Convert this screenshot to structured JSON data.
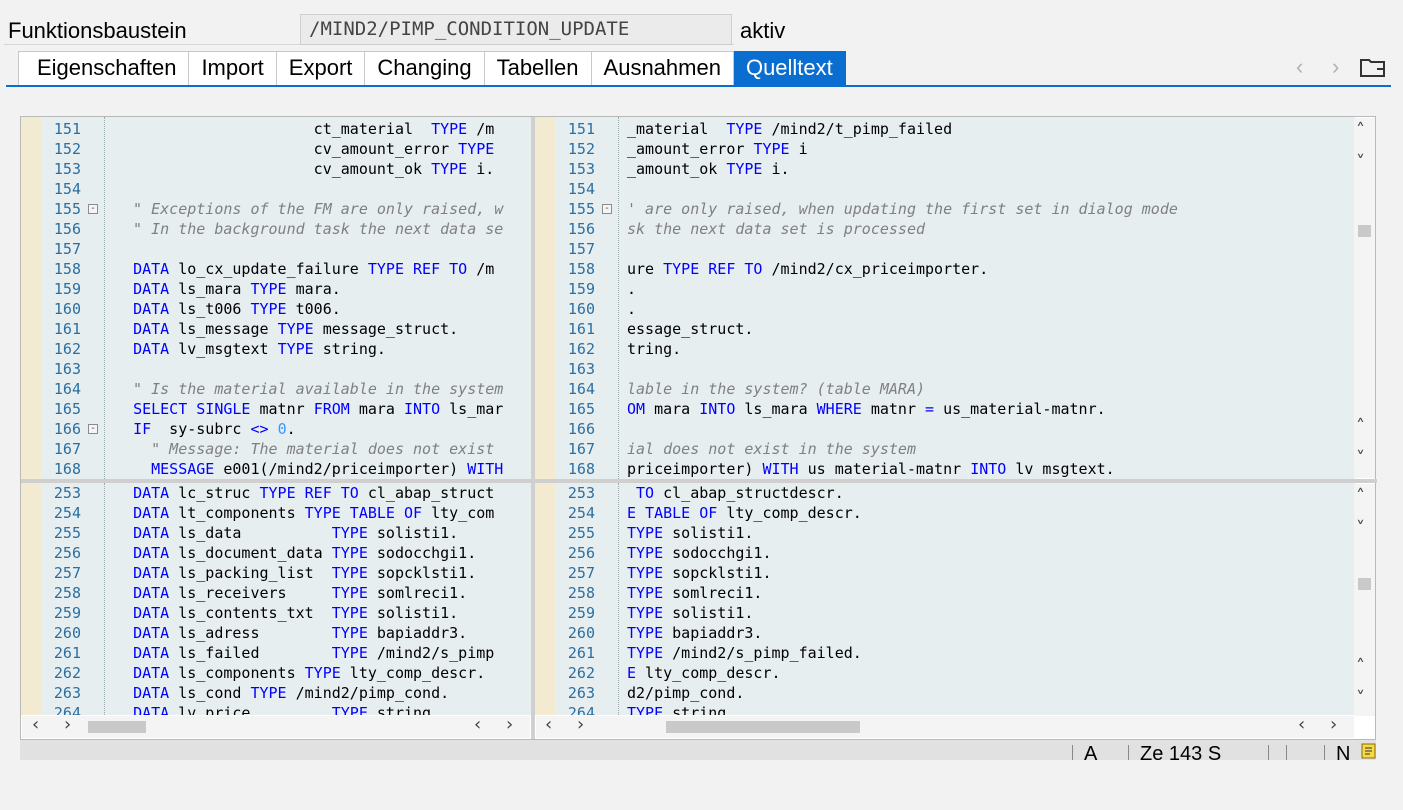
{
  "header": {
    "label": "Funktionsbaustein",
    "value": "/MIND2/PIMP_CONDITION_UPDATE",
    "status": "aktiv"
  },
  "tabs": [
    {
      "label": "Eigenschaften"
    },
    {
      "label": "Import"
    },
    {
      "label": "Export"
    },
    {
      "label": "Changing"
    },
    {
      "label": "Tabellen"
    },
    {
      "label": "Ausnahmen"
    },
    {
      "label": "Quelltext",
      "active": true
    }
  ],
  "icons": {
    "prev": "chevron-left-icon",
    "next": "chevron-right-icon",
    "folder": "folder-icon"
  },
  "colors": {
    "accent": "#0a6ed1",
    "keyword": "#0000ff",
    "comment": "#808080",
    "number": "#3399ff",
    "editor_bg": "#e7eef0",
    "gutter": "#f3ead2"
  },
  "editor": {
    "top_left": [
      {
        "n": "151",
        "t": [
          [
            "tx",
            "                      ct_material  "
          ],
          [
            "kw",
            "TYPE"
          ],
          [
            "tx",
            " /m"
          ]
        ]
      },
      {
        "n": "152",
        "t": [
          [
            "tx",
            "                      cv_amount_error "
          ],
          [
            "kw",
            "TYPE"
          ]
        ]
      },
      {
        "n": "153",
        "t": [
          [
            "tx",
            "                      cv_amount_ok "
          ],
          [
            "kw",
            "TYPE"
          ],
          [
            "tx",
            " i."
          ]
        ]
      },
      {
        "n": "154",
        "t": []
      },
      {
        "n": "155",
        "t": [
          [
            "cm",
            "  \" Exceptions of the FM are only raised, w"
          ]
        ],
        "fold": "minus"
      },
      {
        "n": "156",
        "t": [
          [
            "cm",
            "  \" In the background task the next data se"
          ]
        ]
      },
      {
        "n": "157",
        "t": []
      },
      {
        "n": "158",
        "t": [
          [
            "tx",
            "  "
          ],
          [
            "kw",
            "DATA"
          ],
          [
            "tx",
            " lo_cx_update_failure "
          ],
          [
            "kw",
            "TYPE REF TO"
          ],
          [
            "tx",
            " /m"
          ]
        ]
      },
      {
        "n": "159",
        "t": [
          [
            "tx",
            "  "
          ],
          [
            "kw",
            "DATA"
          ],
          [
            "tx",
            " ls_mara "
          ],
          [
            "kw",
            "TYPE"
          ],
          [
            "tx",
            " mara."
          ]
        ]
      },
      {
        "n": "160",
        "t": [
          [
            "tx",
            "  "
          ],
          [
            "kw",
            "DATA"
          ],
          [
            "tx",
            " ls_t006 "
          ],
          [
            "kw",
            "TYPE"
          ],
          [
            "tx",
            " t006."
          ]
        ]
      },
      {
        "n": "161",
        "t": [
          [
            "tx",
            "  "
          ],
          [
            "kw",
            "DATA"
          ],
          [
            "tx",
            " ls_message "
          ],
          [
            "kw",
            "TYPE"
          ],
          [
            "tx",
            " message_struct."
          ]
        ]
      },
      {
        "n": "162",
        "t": [
          [
            "tx",
            "  "
          ],
          [
            "kw",
            "DATA"
          ],
          [
            "tx",
            " lv_msgtext "
          ],
          [
            "kw",
            "TYPE"
          ],
          [
            "tx",
            " string."
          ]
        ]
      },
      {
        "n": "163",
        "t": []
      },
      {
        "n": "164",
        "t": [
          [
            "cm",
            "  \" Is the material available in the system"
          ]
        ]
      },
      {
        "n": "165",
        "t": [
          [
            "tx",
            "  "
          ],
          [
            "kw",
            "SELECT SINGLE"
          ],
          [
            "tx",
            " matnr "
          ],
          [
            "kw",
            "FROM"
          ],
          [
            "tx",
            " mara "
          ],
          [
            "kw",
            "INTO"
          ],
          [
            "tx",
            " ls_mar"
          ]
        ]
      },
      {
        "n": "166",
        "t": [
          [
            "tx",
            "  "
          ],
          [
            "kw",
            "IF"
          ],
          [
            "tx",
            "  sy-subrc "
          ],
          [
            "kw",
            "<>"
          ],
          [
            "tx",
            " "
          ],
          [
            "nm",
            "0"
          ],
          [
            "tx",
            "."
          ]
        ],
        "fold": "minus"
      },
      {
        "n": "167",
        "t": [
          [
            "cm",
            "    \" Message: The material does not exist"
          ]
        ]
      },
      {
        "n": "168",
        "t": [
          [
            "tx",
            "    "
          ],
          [
            "kw",
            "MESSAGE"
          ],
          [
            "tx",
            " e001(/mind2/priceimporter) "
          ],
          [
            "kw",
            "WITH"
          ]
        ]
      }
    ],
    "top_right": [
      {
        "n": "151",
        "t": [
          [
            "tx",
            "_material  "
          ],
          [
            "kw",
            "TYPE"
          ],
          [
            "tx",
            " /mind2/t_pimp_failed"
          ]
        ]
      },
      {
        "n": "152",
        "t": [
          [
            "tx",
            "_amount_error "
          ],
          [
            "kw",
            "TYPE"
          ],
          [
            "tx",
            " i"
          ]
        ]
      },
      {
        "n": "153",
        "t": [
          [
            "tx",
            "_amount_ok "
          ],
          [
            "kw",
            "TYPE"
          ],
          [
            "tx",
            " i."
          ]
        ]
      },
      {
        "n": "154",
        "t": []
      },
      {
        "n": "155",
        "t": [
          [
            "cm",
            "' are only raised, when updating the first set in dialog mode"
          ]
        ],
        "fold": "minus"
      },
      {
        "n": "156",
        "t": [
          [
            "cm",
            "sk the next data set is processed"
          ]
        ]
      },
      {
        "n": "157",
        "t": []
      },
      {
        "n": "158",
        "t": [
          [
            "tx",
            "ure "
          ],
          [
            "kw",
            "TYPE REF TO"
          ],
          [
            "tx",
            " /mind2/cx_priceimporter."
          ]
        ]
      },
      {
        "n": "159",
        "t": [
          [
            "tx",
            "."
          ]
        ]
      },
      {
        "n": "160",
        "t": [
          [
            "tx",
            "."
          ]
        ]
      },
      {
        "n": "161",
        "t": [
          [
            "tx",
            "essage_struct."
          ]
        ]
      },
      {
        "n": "162",
        "t": [
          [
            "tx",
            "tring."
          ]
        ]
      },
      {
        "n": "163",
        "t": []
      },
      {
        "n": "164",
        "t": [
          [
            "cm",
            "lable in the system? (table MARA)"
          ]
        ]
      },
      {
        "n": "165",
        "t": [
          [
            "kw",
            "OM"
          ],
          [
            "tx",
            " mara "
          ],
          [
            "kw",
            "INTO"
          ],
          [
            "tx",
            " ls_mara "
          ],
          [
            "kw",
            "WHERE"
          ],
          [
            "tx",
            " matnr "
          ],
          [
            "kw",
            "="
          ],
          [
            "tx",
            " us_material-matnr."
          ]
        ]
      },
      {
        "n": "166",
        "t": []
      },
      {
        "n": "167",
        "t": [
          [
            "cm",
            "ial does not exist in the system"
          ]
        ]
      },
      {
        "n": "168",
        "t": [
          [
            "tx",
            "priceimporter) "
          ],
          [
            "kw",
            "WITH"
          ],
          [
            "tx",
            " us material-matnr "
          ],
          [
            "kw",
            "INTO"
          ],
          [
            "tx",
            " lv msgtext."
          ]
        ]
      }
    ],
    "bottom_left": [
      {
        "n": "253",
        "t": [
          [
            "tx",
            "  "
          ],
          [
            "kw",
            "DATA"
          ],
          [
            "tx",
            " lc_struc "
          ],
          [
            "kw",
            "TYPE REF TO"
          ],
          [
            "tx",
            " cl_abap_struct"
          ]
        ]
      },
      {
        "n": "254",
        "t": [
          [
            "tx",
            "  "
          ],
          [
            "kw",
            "DATA"
          ],
          [
            "tx",
            " lt_components "
          ],
          [
            "kw",
            "TYPE TABLE OF"
          ],
          [
            "tx",
            " lty_com"
          ]
        ]
      },
      {
        "n": "255",
        "t": [
          [
            "tx",
            "  "
          ],
          [
            "kw",
            "DATA"
          ],
          [
            "tx",
            " ls_data          "
          ],
          [
            "kw",
            "TYPE"
          ],
          [
            "tx",
            " solisti1."
          ]
        ]
      },
      {
        "n": "256",
        "t": [
          [
            "tx",
            "  "
          ],
          [
            "kw",
            "DATA"
          ],
          [
            "tx",
            " ls_document_data "
          ],
          [
            "kw",
            "TYPE"
          ],
          [
            "tx",
            " sodocchgi1."
          ]
        ]
      },
      {
        "n": "257",
        "t": [
          [
            "tx",
            "  "
          ],
          [
            "kw",
            "DATA"
          ],
          [
            "tx",
            " ls_packing_list  "
          ],
          [
            "kw",
            "TYPE"
          ],
          [
            "tx",
            " sopcklsti1."
          ]
        ]
      },
      {
        "n": "258",
        "t": [
          [
            "tx",
            "  "
          ],
          [
            "kw",
            "DATA"
          ],
          [
            "tx",
            " ls_receivers     "
          ],
          [
            "kw",
            "TYPE"
          ],
          [
            "tx",
            " somlreci1."
          ]
        ]
      },
      {
        "n": "259",
        "t": [
          [
            "tx",
            "  "
          ],
          [
            "kw",
            "DATA"
          ],
          [
            "tx",
            " ls_contents_txt  "
          ],
          [
            "kw",
            "TYPE"
          ],
          [
            "tx",
            " solisti1."
          ]
        ]
      },
      {
        "n": "260",
        "t": [
          [
            "tx",
            "  "
          ],
          [
            "kw",
            "DATA"
          ],
          [
            "tx",
            " ls_adress        "
          ],
          [
            "kw",
            "TYPE"
          ],
          [
            "tx",
            " bapiaddr3."
          ]
        ]
      },
      {
        "n": "261",
        "t": [
          [
            "tx",
            "  "
          ],
          [
            "kw",
            "DATA"
          ],
          [
            "tx",
            " ls_failed        "
          ],
          [
            "kw",
            "TYPE"
          ],
          [
            "tx",
            " /mind2/s_pimp"
          ]
        ]
      },
      {
        "n": "262",
        "t": [
          [
            "tx",
            "  "
          ],
          [
            "kw",
            "DATA"
          ],
          [
            "tx",
            " ls_components "
          ],
          [
            "kw",
            "TYPE"
          ],
          [
            "tx",
            " lty_comp_descr."
          ]
        ]
      },
      {
        "n": "263",
        "t": [
          [
            "tx",
            "  "
          ],
          [
            "kw",
            "DATA"
          ],
          [
            "tx",
            " ls_cond "
          ],
          [
            "kw",
            "TYPE"
          ],
          [
            "tx",
            " /mind2/pimp_cond."
          ]
        ]
      },
      {
        "n": "264",
        "t": [
          [
            "tx",
            "  "
          ],
          [
            "kw",
            "DATA"
          ],
          [
            "tx",
            " lv_price         "
          ],
          [
            "kw",
            "TYPE"
          ],
          [
            "tx",
            " string"
          ]
        ]
      }
    ],
    "bottom_right": [
      {
        "n": "253",
        "t": [
          [
            "tx",
            " "
          ],
          [
            "kw",
            "TO"
          ],
          [
            "tx",
            " cl_abap_structdescr."
          ]
        ]
      },
      {
        "n": "254",
        "t": [
          [
            "kw",
            "E TABLE OF"
          ],
          [
            "tx",
            " lty_comp_descr."
          ]
        ]
      },
      {
        "n": "255",
        "t": [
          [
            "kw",
            "TYPE"
          ],
          [
            "tx",
            " solisti1."
          ]
        ]
      },
      {
        "n": "256",
        "t": [
          [
            "kw",
            "TYPE"
          ],
          [
            "tx",
            " sodocchgi1."
          ]
        ]
      },
      {
        "n": "257",
        "t": [
          [
            "kw",
            "TYPE"
          ],
          [
            "tx",
            " sopcklsti1."
          ]
        ]
      },
      {
        "n": "258",
        "t": [
          [
            "kw",
            "TYPE"
          ],
          [
            "tx",
            " somlreci1."
          ]
        ]
      },
      {
        "n": "259",
        "t": [
          [
            "kw",
            "TYPE"
          ],
          [
            "tx",
            " solisti1."
          ]
        ]
      },
      {
        "n": "260",
        "t": [
          [
            "kw",
            "TYPE"
          ],
          [
            "tx",
            " bapiaddr3."
          ]
        ]
      },
      {
        "n": "261",
        "t": [
          [
            "kw",
            "TYPE"
          ],
          [
            "tx",
            " /mind2/s_pimp_failed."
          ]
        ]
      },
      {
        "n": "262",
        "t": [
          [
            "kw",
            "E"
          ],
          [
            "tx",
            " lty_comp_descr."
          ]
        ]
      },
      {
        "n": "263",
        "t": [
          [
            "tx",
            "d2/pimp_cond."
          ]
        ]
      },
      {
        "n": "264",
        "t": [
          [
            "kw",
            "TYPE"
          ],
          [
            "tx",
            " string"
          ]
        ]
      }
    ]
  },
  "statusbar": {
    "mode": "A",
    "position": "Ze 143 S",
    "insert": "N"
  }
}
